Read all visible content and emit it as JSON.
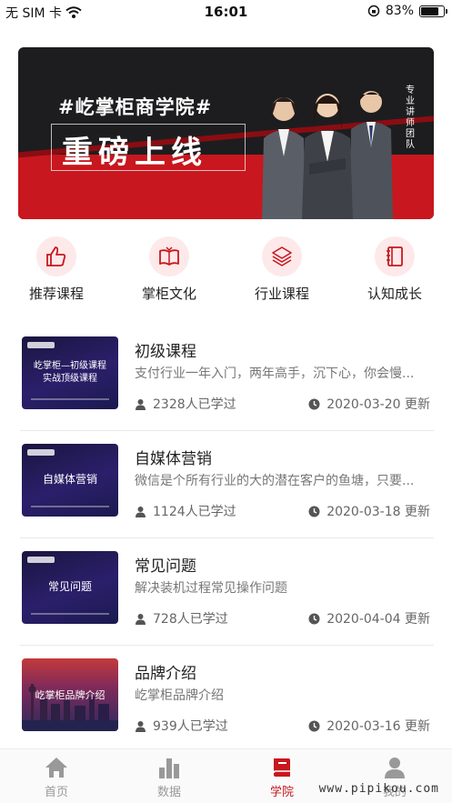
{
  "status_bar": {
    "carrier": "无 SIM 卡",
    "time": "16:01",
    "battery_percent": "83%",
    "battery_level": 0.83
  },
  "banner": {
    "tag": "#屹掌柜商学院#",
    "headline": "重磅上线",
    "side_text": "专业讲师团队"
  },
  "quick_nav": [
    {
      "label": "推荐课程",
      "icon": "thumbs-up-icon"
    },
    {
      "label": "掌柜文化",
      "icon": "open-book-icon"
    },
    {
      "label": "行业课程",
      "icon": "layers-icon"
    },
    {
      "label": "认知成长",
      "icon": "notebook-icon"
    }
  ],
  "courses": [
    {
      "title": "初级课程",
      "description": "支付行业一年入门，两年高手，沉下心，你会慢...",
      "learners": "2328人已学过",
      "updated": "2020-03-20 更新",
      "thumb_text": "屹掌柜—初级课程\n实战顶级课程"
    },
    {
      "title": "自媒体营销",
      "description": "微信是个所有行业的大的潜在客户的鱼塘，只要...",
      "learners": "1124人已学过",
      "updated": "2020-03-18 更新",
      "thumb_text": "自媒体营销"
    },
    {
      "title": "常见问题",
      "description": "解决装机过程常见操作问题",
      "learners": "728人已学过",
      "updated": "2020-04-04 更新",
      "thumb_text": "常见问题"
    },
    {
      "title": "品牌介绍",
      "description": "屹掌柜品牌介绍",
      "learners": "939人已学过",
      "updated": "2020-03-16 更新",
      "thumb_text": "屹掌柜品牌介绍"
    }
  ],
  "tab_bar": {
    "tabs": [
      {
        "label": "首页",
        "icon": "home-icon",
        "active": false
      },
      {
        "label": "数据",
        "icon": "bar-chart-icon",
        "active": false
      },
      {
        "label": "学院",
        "icon": "book-icon",
        "active": true
      },
      {
        "label": "我的",
        "icon": "user-icon",
        "active": false
      }
    ]
  },
  "watermark": "www.pipikou.com",
  "colors": {
    "accent": "#c8171e",
    "icon_bg": "#fde9e9",
    "text_muted": "#777777"
  }
}
